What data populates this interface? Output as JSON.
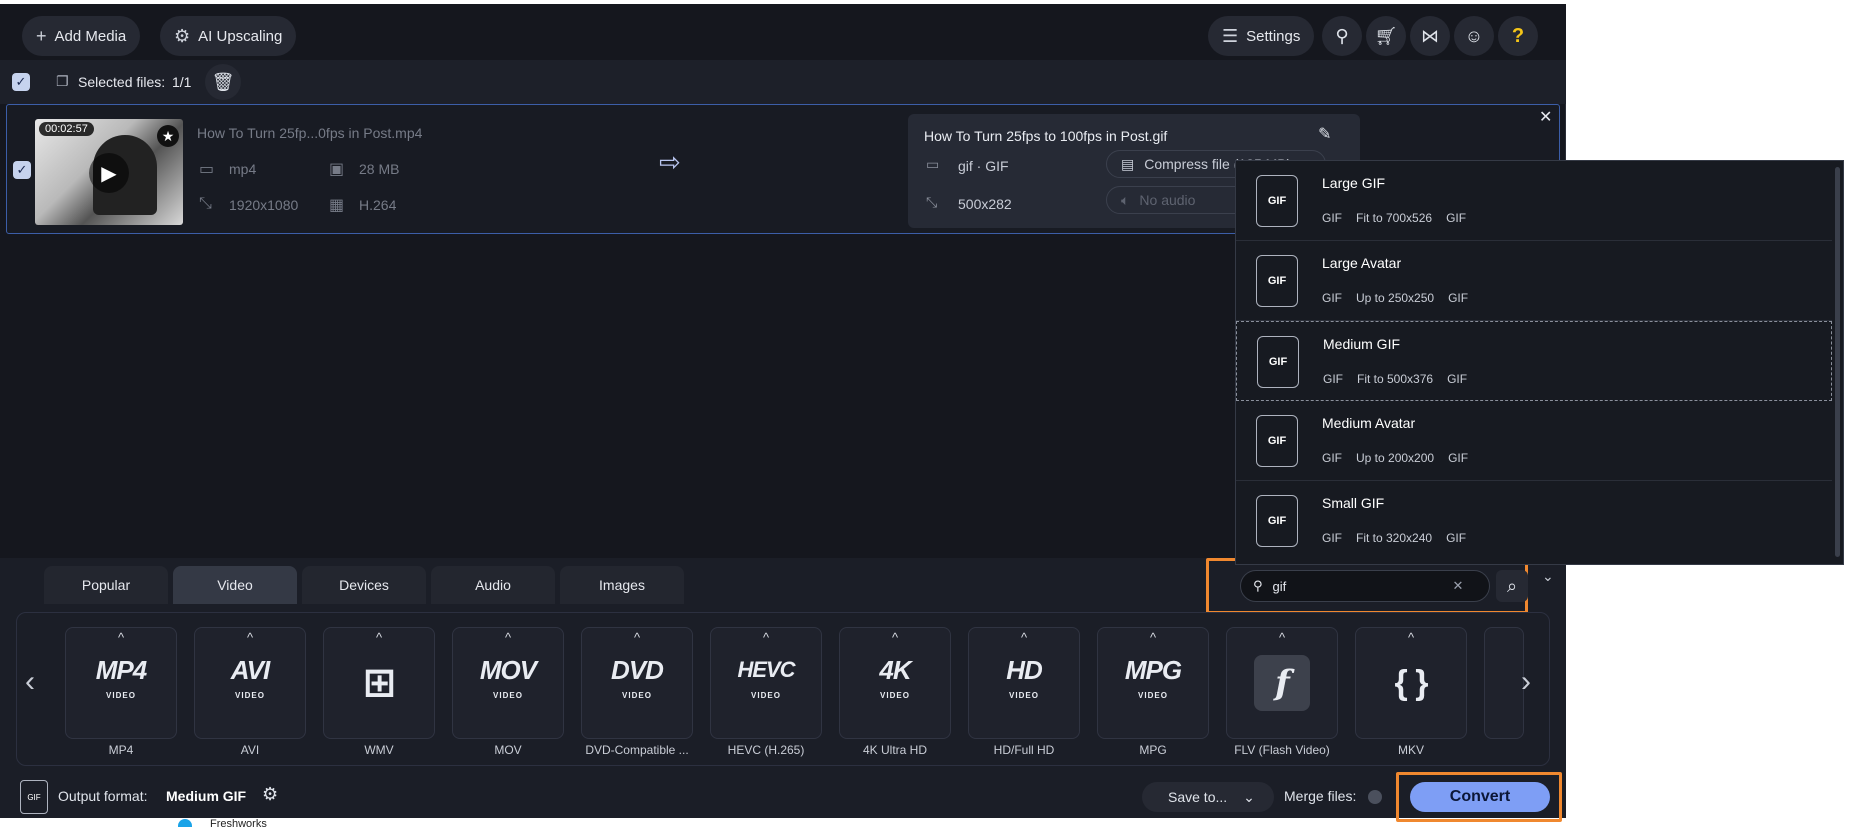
{
  "toolbar": {
    "add_media": "Add Media",
    "ai_upscaling": "AI Upscaling",
    "settings": "Settings"
  },
  "selection": {
    "label": "Selected files:",
    "count": "1/1"
  },
  "file": {
    "duration": "00:02:57",
    "name": "How To Turn 25fp...0fps in Post.mp4",
    "container": "mp4",
    "size": "28 MB",
    "resolution": "1920x1080",
    "codec": "H.264"
  },
  "output": {
    "name": "How To Turn 25fps to 100fps in Post.gif",
    "format": "gif · GIF",
    "resolution": "500x282",
    "compress": "Compress file (125 MB)",
    "audio": "No audio"
  },
  "presets": [
    {
      "name": "Large GIF",
      "a": "GIF",
      "b": "Fit to 700x526",
      "c": "GIF",
      "icon": "GIF"
    },
    {
      "name": "Large Avatar",
      "a": "GIF",
      "b": "Up to 250x250",
      "c": "GIF",
      "icon": "GIF"
    },
    {
      "name": "Medium GIF",
      "a": "GIF",
      "b": "Fit to 500x376",
      "c": "GIF",
      "icon": "GIF"
    },
    {
      "name": "Medium Avatar",
      "a": "GIF",
      "b": "Up to 200x200",
      "c": "GIF",
      "icon": "GIF"
    },
    {
      "name": "Small GIF",
      "a": "GIF",
      "b": "Fit to 320x240",
      "c": "GIF",
      "icon": "GIF"
    }
  ],
  "tabs": [
    "Popular",
    "Video",
    "Devices",
    "Audio",
    "Images"
  ],
  "search": {
    "value": "gif"
  },
  "formats": [
    {
      "logo": "MP4",
      "sub": "VIDEO",
      "label": "MP4"
    },
    {
      "logo": "AVI",
      "sub": "VIDEO",
      "label": "AVI"
    },
    {
      "logo": "",
      "sub": "",
      "label": "WMV"
    },
    {
      "logo": "MOV",
      "sub": "VIDEO",
      "label": "MOV"
    },
    {
      "logo": "DVD",
      "sub": "VIDEO",
      "label": "DVD-Compatible ..."
    },
    {
      "logo": "HEVC",
      "sub": "VIDEO",
      "label": "HEVC (H.265)"
    },
    {
      "logo": "4K",
      "sub": "VIDEO",
      "label": "4K Ultra HD"
    },
    {
      "logo": "HD",
      "sub": "VIDEO",
      "label": "HD/Full HD"
    },
    {
      "logo": "MPG",
      "sub": "VIDEO",
      "label": "MPG"
    },
    {
      "logo": "f",
      "sub": "",
      "label": "FLV (Flash Video)"
    },
    {
      "logo": "{ }",
      "sub": "",
      "label": "MKV"
    }
  ],
  "footer": {
    "output_label": "Output format:",
    "output_value": "Medium GIF",
    "save_to": "Save to...",
    "merge_files": "Merge files:",
    "convert": "Convert"
  },
  "taskbar": {
    "app": "Freshworks"
  }
}
